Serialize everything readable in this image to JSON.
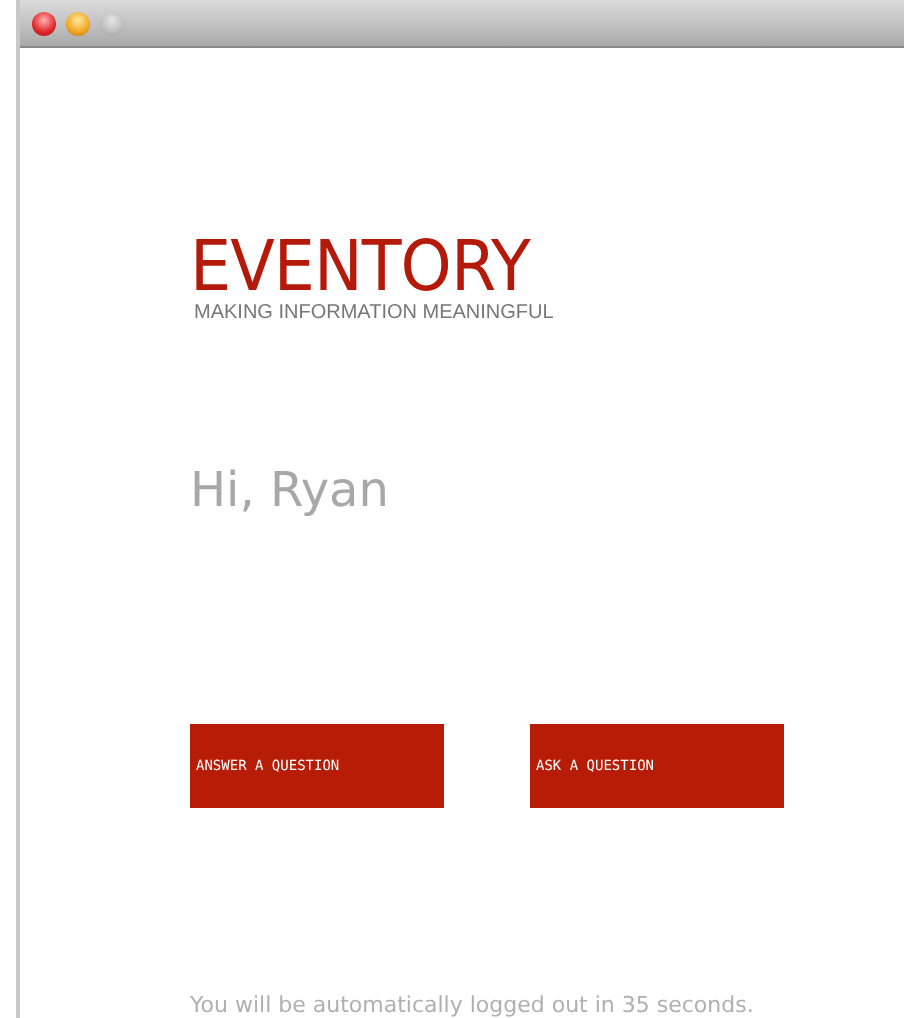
{
  "window": {
    "controls": [
      {
        "kind": "close",
        "disabled": false
      },
      {
        "kind": "minimize",
        "disabled": false
      },
      {
        "kind": "zoom",
        "disabled": true
      }
    ]
  },
  "logo": {
    "name": "EVENTORY",
    "tagline": "MAKING INFORMATION MEANINGFUL"
  },
  "greeting": "Hi, Ryan",
  "buttons": [
    "ANSWER A QUESTION",
    "ASK A QUESTION"
  ],
  "footer": "You will be automatically logged out in 35 seconds."
}
